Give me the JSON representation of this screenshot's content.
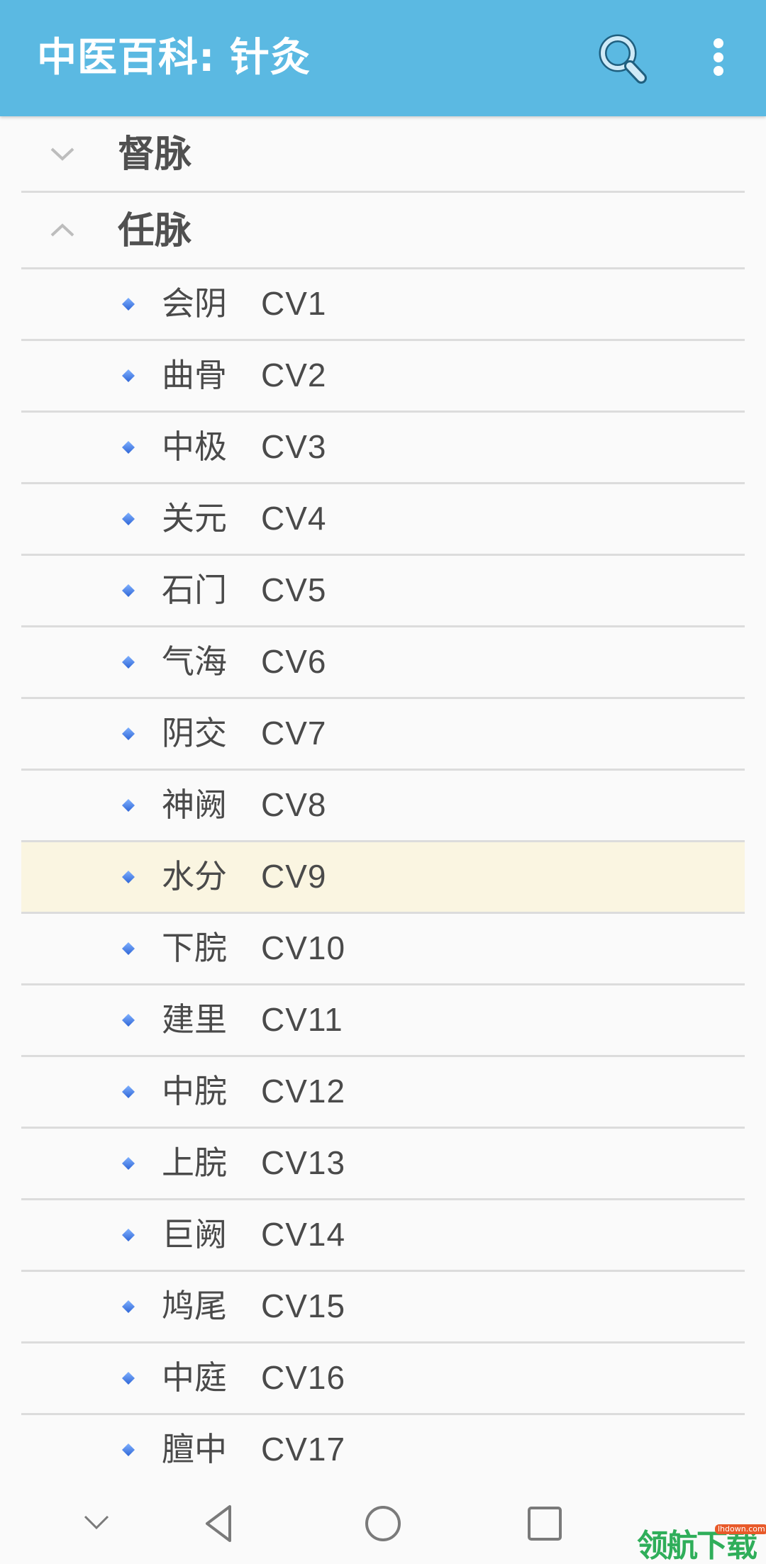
{
  "appbar": {
    "title": "中医百科: 针灸",
    "search_icon": "search-icon",
    "menu_icon": "more-vert-icon",
    "color": "#5bb9e2"
  },
  "groups": [
    {
      "title": "督脉",
      "expanded": false,
      "chevron_icon": "chevron-down-icon"
    },
    {
      "title": "任脉",
      "expanded": true,
      "chevron_icon": "chevron-up-icon"
    }
  ],
  "items": [
    {
      "name": "会阴",
      "code": "CV1",
      "selected": false
    },
    {
      "name": "曲骨",
      "code": "CV2",
      "selected": false
    },
    {
      "name": "中极",
      "code": "CV3",
      "selected": false
    },
    {
      "name": "关元",
      "code": "CV4",
      "selected": false
    },
    {
      "name": "石门",
      "code": "CV5",
      "selected": false
    },
    {
      "name": "气海",
      "code": "CV6",
      "selected": false
    },
    {
      "name": "阴交",
      "code": "CV7",
      "selected": false
    },
    {
      "name": "神阙",
      "code": "CV8",
      "selected": false
    },
    {
      "name": "水分",
      "code": "CV9",
      "selected": true
    },
    {
      "name": "下脘",
      "code": "CV10",
      "selected": false
    },
    {
      "name": "建里",
      "code": "CV11",
      "selected": false
    },
    {
      "name": "中脘",
      "code": "CV12",
      "selected": false
    },
    {
      "name": "上脘",
      "code": "CV13",
      "selected": false
    },
    {
      "name": "巨阙",
      "code": "CV14",
      "selected": false
    },
    {
      "name": "鸠尾",
      "code": "CV15",
      "selected": false
    },
    {
      "name": "中庭",
      "code": "CV16",
      "selected": false
    },
    {
      "name": "膻中",
      "code": "CV17",
      "selected": false
    }
  ],
  "colors": {
    "selected_row": "#faf5e1",
    "bullet": "#3f7de8",
    "divider": "#dcdcdc"
  },
  "navbar": {
    "buttons": [
      "hide-nav",
      "back",
      "home",
      "recents"
    ]
  },
  "watermark": {
    "text": "领航下载",
    "url": "lhdown.com"
  }
}
